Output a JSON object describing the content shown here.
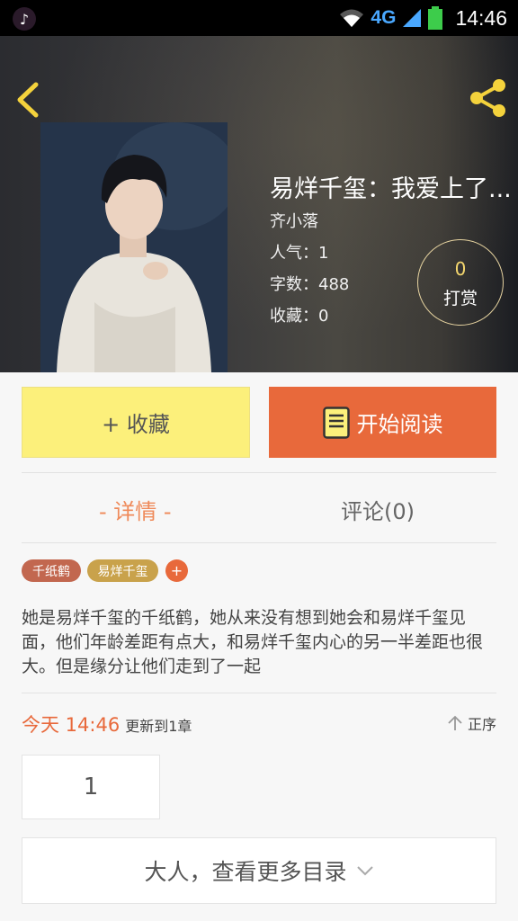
{
  "status_bar": {
    "time": "14:46",
    "network": "4G",
    "app_icon": "tiktok-icon"
  },
  "book": {
    "title": "易烊千玺：我爱上了...",
    "author": "齐小落",
    "popularity": "人气：1",
    "word_count": "字数：488",
    "favorites": "收藏：0"
  },
  "reward": {
    "count": "0",
    "label": "打赏"
  },
  "actions": {
    "collect_label": "+ 收藏",
    "read_label": "开始阅读"
  },
  "tabs": [
    {
      "label": "- 详情 -",
      "active": true
    },
    {
      "label": "评论(0)",
      "active": false
    }
  ],
  "tags": [
    {
      "label": "千纸鹤",
      "color": "#c2674f"
    },
    {
      "label": "易烊千玺",
      "color": "#c9a24b"
    }
  ],
  "tag_add_label": "+",
  "description": "她是易烊千玺的千纸鹤，她从来没有想到她会和易烊千玺见面，他们年龄差距有点大，和易烊千玺内心的另一半差距也很大。但是缘分让他们走到了一起",
  "update": {
    "time": "今天 14:46",
    "info": "更新到1章",
    "order_label": "正序"
  },
  "chapter_number": "1",
  "more_catalog_label": "大人，查看更多目录",
  "colors": {
    "accent": "#e8693b",
    "collect_bg": "#fcf07b",
    "tab_active": "#ef8a5a"
  }
}
